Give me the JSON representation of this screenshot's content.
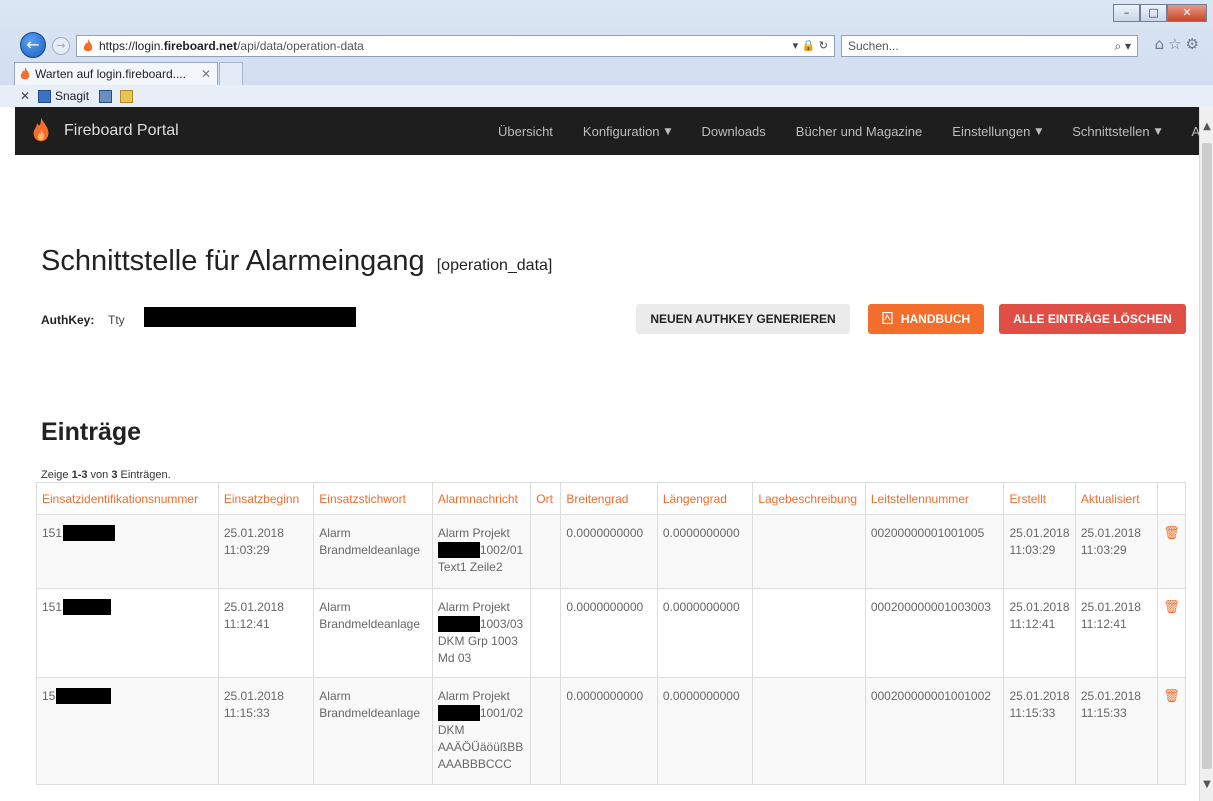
{
  "browser": {
    "url_prefix": "https://login.",
    "url_host": "fireboard.net",
    "url_path": "/api/data/operation-data",
    "search_placeholder": "Suchen...",
    "tab_title": "Warten auf login.fireboard....",
    "favorites": [
      "Snagit"
    ]
  },
  "navbar": {
    "brand": "Fireboard Portal",
    "items": [
      {
        "label": "Übersicht",
        "dropdown": false
      },
      {
        "label": "Konfiguration",
        "dropdown": true
      },
      {
        "label": "Downloads",
        "dropdown": false
      },
      {
        "label": "Bücher und Magazine",
        "dropdown": false
      },
      {
        "label": "Einstellungen",
        "dropdown": true
      },
      {
        "label": "Schnittstellen",
        "dropdown": true
      },
      {
        "label": "Abmelden",
        "dropdown": false
      }
    ]
  },
  "page": {
    "title": "Schnittstelle für Alarmeingang",
    "subtitle": "[operation_data]",
    "auth_label": "AuthKey:",
    "auth_value_visible": "Tty",
    "btn_generate": "NEUEN AUTHKEY GENERIEREN",
    "btn_manual": "HANDBUCH",
    "btn_delete_all": "ALLE EINTRÄGE LÖSCHEN",
    "section_title": "Einträge",
    "summary_prefix": "Zeige ",
    "summary_range": "1-3",
    "summary_mid": " von ",
    "summary_total": "3",
    "summary_suffix": " Einträgen."
  },
  "table": {
    "columns": [
      "Einsatzidentifikationsnummer",
      "Einsatzbeginn",
      "Einsatzstichwort",
      "Alarmnachricht",
      "Ort",
      "Breitengrad",
      "Längengrad",
      "Lagebeschreibung",
      "Leitstellennummer",
      "Erstellt",
      "Aktualisiert",
      ""
    ],
    "rows": [
      {
        "id_prefix": "151",
        "beginn": [
          "25.01.2018",
          "11:03:29"
        ],
        "stichwort": [
          "Alarm",
          "Brandmeldeanlage"
        ],
        "nachricht_line1": "Alarm Projekt",
        "nachricht_suffix": "1002/01",
        "nachricht_rest": [
          "Text1 Zeile2"
        ],
        "ort": "",
        "breite": "0.0000000000",
        "laenge": "0.0000000000",
        "lage": "",
        "leitstelle": "00200000001001005",
        "erstellt": [
          "25.01.2018",
          "11:03:29"
        ],
        "aktualisiert": [
          "25.01.2018",
          "11:03:29"
        ]
      },
      {
        "id_prefix": "151",
        "beginn": [
          "25.01.2018",
          "11:12:41"
        ],
        "stichwort": [
          "Alarm",
          "Brandmeldeanlage"
        ],
        "nachricht_line1": "Alarm Projekt",
        "nachricht_suffix": "1003/03",
        "nachricht_rest": [
          "DKM Grp 1003",
          "Md 03"
        ],
        "ort": "",
        "breite": "0.0000000000",
        "laenge": "0.0000000000",
        "lage": "",
        "leitstelle": "000200000001003003",
        "erstellt": [
          "25.01.2018",
          "11:12:41"
        ],
        "aktualisiert": [
          "25.01.2018",
          "11:12:41"
        ]
      },
      {
        "id_prefix": "15",
        "beginn": [
          "25.01.2018",
          "11:15:33"
        ],
        "stichwort": [
          "Alarm",
          "Brandmeldeanlage"
        ],
        "nachricht_line1": "Alarm Projekt",
        "nachricht_suffix": "1001/02",
        "nachricht_rest": [
          "DKM",
          "AAÄÖÜäöüßBB",
          "AAABBBCCC"
        ],
        "ort": "",
        "breite": "0.0000000000",
        "laenge": "0.0000000000",
        "lage": "",
        "leitstelle": "000200000001001002",
        "erstellt": [
          "25.01.2018",
          "11:15:33"
        ],
        "aktualisiert": [
          "25.01.2018",
          "11:15:33"
        ]
      }
    ]
  },
  "colors": {
    "accent_orange": "#f36d2c",
    "danger_red": "#e04f46",
    "navbar_bg": "#1e1e1e",
    "header_text": "#ef6c2c"
  },
  "icons": {
    "brand": "flame-icon",
    "manual": "pdf-icon",
    "row_action": "trash-icon"
  }
}
